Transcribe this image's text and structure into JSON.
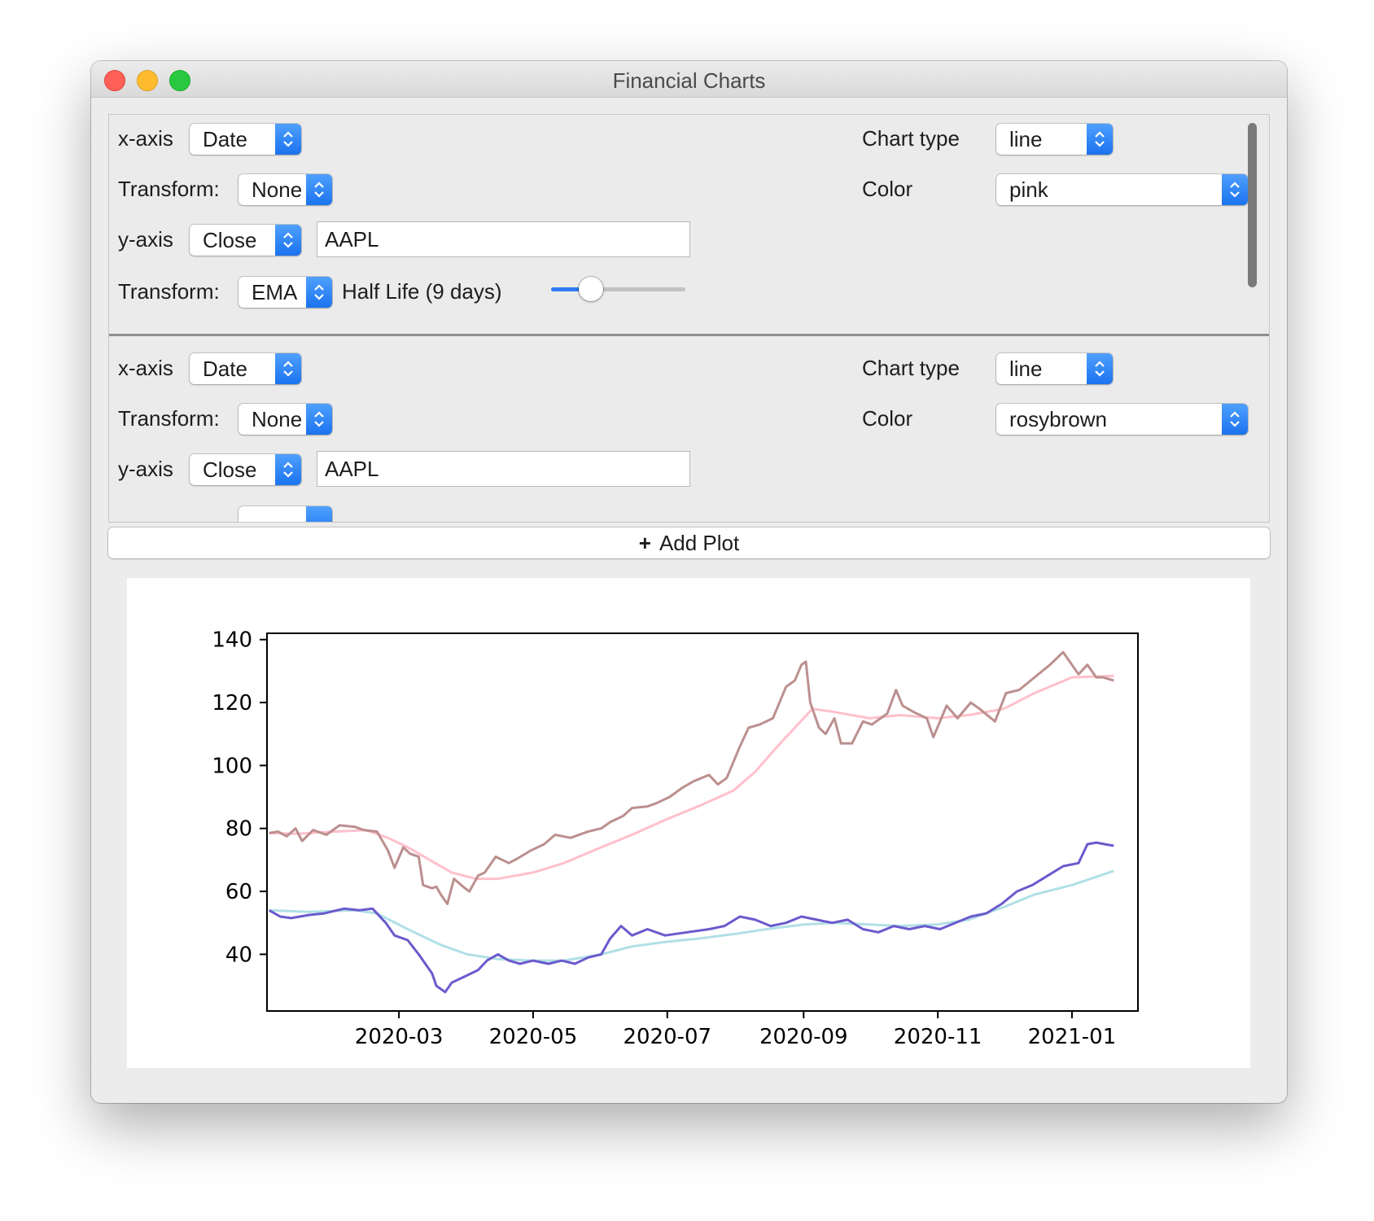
{
  "window": {
    "title": "Financial Charts"
  },
  "plots": [
    {
      "x_axis_label": "x-axis",
      "x_axis": "Date",
      "x_transform_label": "Transform:",
      "x_transform": "None",
      "y_axis_label": "y-axis",
      "y_axis": "Close",
      "ticker": "AAPL",
      "y_transform_label": "Transform:",
      "y_transform": "EMA",
      "half_life_label": "Half Life (9 days)",
      "half_life_days": 9,
      "chart_type_label": "Chart type",
      "chart_type": "line",
      "color_label": "Color",
      "color": "pink"
    },
    {
      "x_axis_label": "x-axis",
      "x_axis": "Date",
      "x_transform_label": "Transform:",
      "x_transform": "None",
      "y_axis_label": "y-axis",
      "y_axis": "Close",
      "ticker": "AAPL",
      "chart_type_label": "Chart type",
      "chart_type": "line",
      "color_label": "Color",
      "color": "rosybrown"
    }
  ],
  "add_plot": {
    "label": "Add Plot"
  },
  "chart_data": {
    "type": "line",
    "xlabel": "",
    "ylabel": "",
    "xlim": [
      "2020-01-01",
      "2021-01-31"
    ],
    "ylim": [
      22,
      142
    ],
    "x_ticks": [
      "2020-03",
      "2020-05",
      "2020-07",
      "2020-09",
      "2020-11",
      "2021-01"
    ],
    "y_ticks": [
      40,
      60,
      80,
      100,
      120,
      140
    ],
    "grid": false,
    "series": [
      {
        "color": "#ffc0cb",
        "points": [
          [
            "2020-01-02",
            78.5
          ],
          [
            "2020-01-15",
            78.3
          ],
          [
            "2020-02-01",
            79
          ],
          [
            "2020-02-15",
            79.5
          ],
          [
            "2020-02-25",
            77
          ],
          [
            "2020-03-05",
            74
          ],
          [
            "2020-03-15",
            70
          ],
          [
            "2020-03-25",
            66
          ],
          [
            "2020-04-05",
            64
          ],
          [
            "2020-04-15",
            64
          ],
          [
            "2020-05-01",
            66
          ],
          [
            "2020-05-15",
            69
          ],
          [
            "2020-06-01",
            74
          ],
          [
            "2020-06-15",
            78
          ],
          [
            "2020-07-01",
            83
          ],
          [
            "2020-07-15",
            87
          ],
          [
            "2020-07-31",
            92
          ],
          [
            "2020-08-10",
            98
          ],
          [
            "2020-08-20",
            106
          ],
          [
            "2020-09-01",
            115
          ],
          [
            "2020-09-05",
            118
          ],
          [
            "2020-09-15",
            117
          ],
          [
            "2020-10-01",
            115
          ],
          [
            "2020-10-15",
            116
          ],
          [
            "2020-11-01",
            115
          ],
          [
            "2020-11-15",
            116
          ],
          [
            "2020-12-01",
            118
          ],
          [
            "2020-12-15",
            123
          ],
          [
            "2021-01-01",
            128
          ],
          [
            "2021-01-20",
            128.5
          ]
        ]
      },
      {
        "color": "#bc8f8f",
        "points": [
          [
            "2020-01-02",
            78.5
          ],
          [
            "2020-01-06",
            79
          ],
          [
            "2020-01-10",
            77.5
          ],
          [
            "2020-01-14",
            80
          ],
          [
            "2020-01-17",
            76
          ],
          [
            "2020-01-22",
            79.5
          ],
          [
            "2020-01-28",
            78
          ],
          [
            "2020-02-03",
            81
          ],
          [
            "2020-02-10",
            80.5
          ],
          [
            "2020-02-14",
            79.5
          ],
          [
            "2020-02-20",
            79
          ],
          [
            "2020-02-25",
            73
          ],
          [
            "2020-02-28",
            67.5
          ],
          [
            "2020-03-03",
            74
          ],
          [
            "2020-03-06",
            72
          ],
          [
            "2020-03-10",
            71
          ],
          [
            "2020-03-12",
            62
          ],
          [
            "2020-03-16",
            61
          ],
          [
            "2020-03-18",
            61.5
          ],
          [
            "2020-03-20",
            59
          ],
          [
            "2020-03-23",
            56
          ],
          [
            "2020-03-26",
            64
          ],
          [
            "2020-03-31",
            61
          ],
          [
            "2020-04-02",
            60
          ],
          [
            "2020-04-06",
            65
          ],
          [
            "2020-04-09",
            66
          ],
          [
            "2020-04-14",
            71
          ],
          [
            "2020-04-20",
            69
          ],
          [
            "2020-04-24",
            70.5
          ],
          [
            "2020-04-30",
            73
          ],
          [
            "2020-05-06",
            75
          ],
          [
            "2020-05-11",
            78
          ],
          [
            "2020-05-18",
            77
          ],
          [
            "2020-05-26",
            79
          ],
          [
            "2020-06-01",
            80
          ],
          [
            "2020-06-05",
            82
          ],
          [
            "2020-06-11",
            84
          ],
          [
            "2020-06-15",
            86.5
          ],
          [
            "2020-06-22",
            87
          ],
          [
            "2020-06-26",
            88
          ],
          [
            "2020-07-02",
            90
          ],
          [
            "2020-07-08",
            93
          ],
          [
            "2020-07-13",
            95
          ],
          [
            "2020-07-20",
            97
          ],
          [
            "2020-07-24",
            94
          ],
          [
            "2020-07-28",
            96
          ],
          [
            "2020-08-03",
            106
          ],
          [
            "2020-08-07",
            112
          ],
          [
            "2020-08-12",
            113
          ],
          [
            "2020-08-18",
            115
          ],
          [
            "2020-08-24",
            125
          ],
          [
            "2020-08-28",
            127
          ],
          [
            "2020-08-31",
            132
          ],
          [
            "2020-09-02",
            133
          ],
          [
            "2020-09-04",
            120
          ],
          [
            "2020-09-08",
            112
          ],
          [
            "2020-09-11",
            110
          ],
          [
            "2020-09-15",
            115
          ],
          [
            "2020-09-18",
            107
          ],
          [
            "2020-09-23",
            107
          ],
          [
            "2020-09-28",
            114
          ],
          [
            "2020-10-02",
            113
          ],
          [
            "2020-10-09",
            116.5
          ],
          [
            "2020-10-13",
            124
          ],
          [
            "2020-10-16",
            119
          ],
          [
            "2020-10-21",
            117
          ],
          [
            "2020-10-27",
            115
          ],
          [
            "2020-10-30",
            109
          ],
          [
            "2020-11-05",
            119
          ],
          [
            "2020-11-10",
            115
          ],
          [
            "2020-11-16",
            120
          ],
          [
            "2020-11-20",
            118
          ],
          [
            "2020-11-27",
            114
          ],
          [
            "2020-12-02",
            123
          ],
          [
            "2020-12-08",
            124
          ],
          [
            "2020-12-15",
            128
          ],
          [
            "2020-12-22",
            132
          ],
          [
            "2020-12-28",
            136
          ],
          [
            "2021-01-04",
            129
          ],
          [
            "2021-01-08",
            132
          ],
          [
            "2021-01-12",
            128
          ],
          [
            "2021-01-15",
            128
          ],
          [
            "2021-01-20",
            127
          ]
        ]
      },
      {
        "color": "#b0e0e6",
        "points": [
          [
            "2020-01-02",
            54
          ],
          [
            "2020-01-20",
            53.5
          ],
          [
            "2020-02-10",
            54
          ],
          [
            "2020-02-20",
            53
          ],
          [
            "2020-03-05",
            48
          ],
          [
            "2020-03-20",
            43
          ],
          [
            "2020-04-01",
            40
          ],
          [
            "2020-04-15",
            38.5
          ],
          [
            "2020-05-01",
            38
          ],
          [
            "2020-05-15",
            38
          ],
          [
            "2020-06-01",
            40
          ],
          [
            "2020-06-15",
            42.5
          ],
          [
            "2020-07-01",
            44
          ],
          [
            "2020-07-15",
            45
          ],
          [
            "2020-08-01",
            46.5
          ],
          [
            "2020-08-15",
            48
          ],
          [
            "2020-09-01",
            49.5
          ],
          [
            "2020-09-15",
            50
          ],
          [
            "2020-10-01",
            49.5
          ],
          [
            "2020-10-15",
            49
          ],
          [
            "2020-11-01",
            49.5
          ],
          [
            "2020-11-15",
            51
          ],
          [
            "2020-12-01",
            55
          ],
          [
            "2020-12-15",
            59
          ],
          [
            "2021-01-01",
            62
          ],
          [
            "2021-01-20",
            66.5
          ]
        ]
      },
      {
        "color": "#6a5acd",
        "points": [
          [
            "2020-01-02",
            54
          ],
          [
            "2020-01-07",
            52
          ],
          [
            "2020-01-12",
            51.5
          ],
          [
            "2020-01-20",
            52.5
          ],
          [
            "2020-01-27",
            53
          ],
          [
            "2020-02-05",
            54.5
          ],
          [
            "2020-02-12",
            54
          ],
          [
            "2020-02-18",
            54.5
          ],
          [
            "2020-02-24",
            50
          ],
          [
            "2020-02-28",
            46
          ],
          [
            "2020-03-05",
            44.5
          ],
          [
            "2020-03-10",
            40
          ],
          [
            "2020-03-14",
            36
          ],
          [
            "2020-03-16",
            34
          ],
          [
            "2020-03-18",
            30
          ],
          [
            "2020-03-22",
            28
          ],
          [
            "2020-03-25",
            31
          ],
          [
            "2020-03-31",
            33
          ],
          [
            "2020-04-06",
            35
          ],
          [
            "2020-04-10",
            38
          ],
          [
            "2020-04-15",
            40
          ],
          [
            "2020-04-20",
            38
          ],
          [
            "2020-04-25",
            37
          ],
          [
            "2020-05-01",
            38
          ],
          [
            "2020-05-08",
            37
          ],
          [
            "2020-05-14",
            38
          ],
          [
            "2020-05-20",
            37
          ],
          [
            "2020-05-26",
            39
          ],
          [
            "2020-06-01",
            40
          ],
          [
            "2020-06-05",
            45
          ],
          [
            "2020-06-10",
            49
          ],
          [
            "2020-06-15",
            46
          ],
          [
            "2020-06-22",
            48
          ],
          [
            "2020-06-30",
            46
          ],
          [
            "2020-07-10",
            47
          ],
          [
            "2020-07-20",
            48
          ],
          [
            "2020-07-27",
            49
          ],
          [
            "2020-08-03",
            52
          ],
          [
            "2020-08-10",
            51
          ],
          [
            "2020-08-17",
            49
          ],
          [
            "2020-08-24",
            50
          ],
          [
            "2020-08-31",
            52
          ],
          [
            "2020-09-07",
            51
          ],
          [
            "2020-09-14",
            50
          ],
          [
            "2020-09-21",
            51
          ],
          [
            "2020-09-28",
            48
          ],
          [
            "2020-10-05",
            47
          ],
          [
            "2020-10-12",
            49
          ],
          [
            "2020-10-19",
            48
          ],
          [
            "2020-10-26",
            49
          ],
          [
            "2020-11-02",
            48
          ],
          [
            "2020-11-09",
            50
          ],
          [
            "2020-11-16",
            52
          ],
          [
            "2020-11-23",
            53
          ],
          [
            "2020-11-30",
            56
          ],
          [
            "2020-12-07",
            60
          ],
          [
            "2020-12-14",
            62
          ],
          [
            "2020-12-21",
            65
          ],
          [
            "2020-12-28",
            68
          ],
          [
            "2021-01-04",
            69
          ],
          [
            "2021-01-08",
            75
          ],
          [
            "2021-01-12",
            75.5
          ],
          [
            "2021-01-16",
            75
          ],
          [
            "2021-01-20",
            74.5
          ]
        ]
      }
    ]
  }
}
